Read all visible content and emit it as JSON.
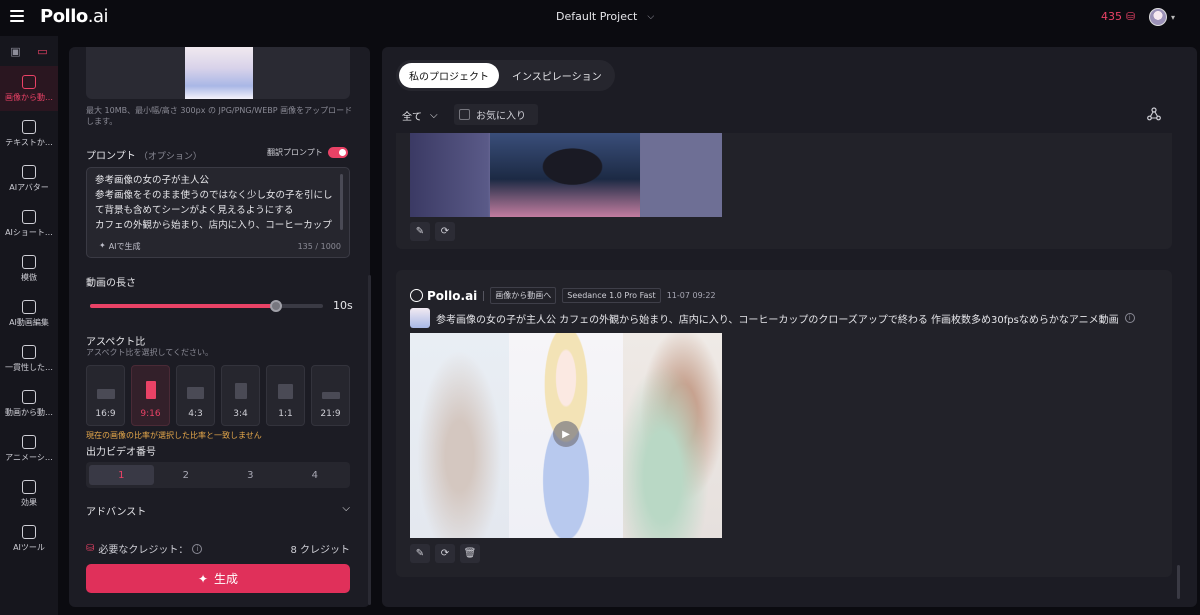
{
  "header": {
    "logo_main": "Pollo",
    "logo_suffix": ".ai",
    "project": "Default Project",
    "credits": "435"
  },
  "sidebar": {
    "items": [
      {
        "label": "画像から動…",
        "icon": "image-video-icon",
        "active": true
      },
      {
        "label": "テキストか…",
        "icon": "text-video-icon"
      },
      {
        "label": "AIアバター",
        "icon": "avatar-icon"
      },
      {
        "label": "AIショート…",
        "icon": "short-icon"
      },
      {
        "label": "模倣",
        "icon": "mimic-icon"
      },
      {
        "label": "AI動画編集",
        "icon": "video-edit-icon"
      },
      {
        "label": "一貫性した…",
        "icon": "consistent-icon"
      },
      {
        "label": "動画から動…",
        "icon": "video-video-icon"
      },
      {
        "label": "アニメーシ…",
        "icon": "animation-icon"
      },
      {
        "label": "効果",
        "icon": "effects-icon"
      },
      {
        "label": "AIツール",
        "icon": "tools-icon"
      }
    ]
  },
  "left": {
    "upload_hint": "最大 10MB、最小幅/高さ 300px の JPG/PNG/WEBP 画像をアップロードします。",
    "prompt_label": "プロンプト",
    "prompt_optional": "（オプション）",
    "translate_label": "翻訳プロンプト",
    "prompt_text": "参考画像の女の子が主人公\n参考画像をそのまま使うのではなく少し女の子を引にして背景も含めてシーンがよく見えるようにする\nカフェの外観から始まり、店内に入り、コーヒーカップのクローズアップで終わる",
    "ai_generate": "AIで生成",
    "char_count": "135 / 1000",
    "duration_label": "動画の長さ",
    "duration_value": "10s",
    "duration_fraction": 0.8,
    "aspect_label": "アスペクト比",
    "aspect_sub": "アスペクト比を選択してください。",
    "ratios": [
      "16:9",
      "9:16",
      "4:3",
      "3:4",
      "1:1",
      "21:9"
    ],
    "warning": "現在の画像の比率が選択した比率と一致しません",
    "output_label": "出力ビデオ番号",
    "outputs": [
      "1",
      "2",
      "3",
      "4"
    ],
    "advanced": "アドバンスト",
    "credits_needed": "必要なクレジット：",
    "credits_value": "8 クレジット",
    "generate": "生成"
  },
  "right": {
    "tabs": [
      "私のプロジェクト",
      "インスピレーション"
    ],
    "filter_all": "全て",
    "favorites": "お気に入り",
    "card2": {
      "brand": "Pollo.ai",
      "tag1": "画像から動画へ",
      "tag2": "Seedance 1.0 Pro Fast",
      "time": "11-07 09:22",
      "prompt": "参考画像の女の子が主人公 カフェの外観から始まり、店内に入り、コーヒーカップのクローズアップで終わる 作画枚数多め30fpsなめらかなアニメ動画"
    }
  },
  "colors": {
    "accent": "#e94266",
    "warning": "#e7a94b"
  }
}
